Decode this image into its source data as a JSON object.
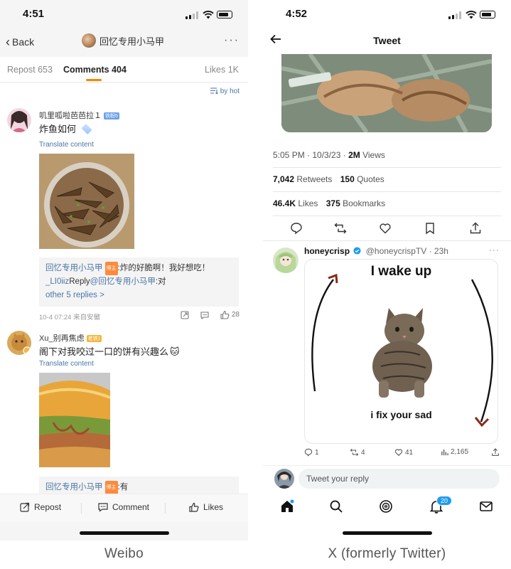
{
  "weibo": {
    "status": {
      "time": "4:51"
    },
    "nav": {
      "back_label": "Back",
      "title": "回忆专用小马甲",
      "more": "···"
    },
    "tabs": {
      "repost": "Repost 653",
      "comments": "Comments 404",
      "likes": "Likes 1K"
    },
    "sort_label": "by hot",
    "comments": [
      {
        "name": "叽里呱啦芭芭拉１",
        "badge": "铁粉5",
        "text": "炸鱼如何",
        "translate": "Translate content",
        "reply_author": "回忆专用小马甲",
        "reply_author_badge": "博主",
        "reply_text": ":炸的好脆啊！我好想吃！",
        "reply_line2_user": "_LI0iiz",
        "reply_line2_mid": "Reply",
        "reply_line2_mention": "@回忆专用小马甲",
        "reply_line2_text": ":对",
        "more_replies": "other 5 replies >",
        "meta": "10-4 07:24 来自安徽",
        "like_count": "28"
      },
      {
        "name": "Xu_别再焦虑",
        "badge": "老铁1",
        "text": "阁下对我咬过一口的饼有兴趣么",
        "translate": "Translate content",
        "reply_author": "回忆专用小马甲",
        "reply_author_badge": "博主",
        "reply_text": ":有"
      }
    ],
    "bottom": {
      "repost": "Repost",
      "comment": "Comment",
      "likes": "Likes"
    },
    "caption": "Weibo"
  },
  "twitter": {
    "status": {
      "time": "4:52"
    },
    "nav": {
      "title": "Tweet"
    },
    "meta_time": "5:05 PM · 10/3/23 · ",
    "meta_views_num": "2M",
    "meta_views_label": " Views",
    "retweets_num": "7,042",
    "retweets_label": " Retweets",
    "quotes_num": "150",
    "quotes_label": " Quotes",
    "likes_num": "46.4K",
    "likes_label": " Likes",
    "bookmarks_num": "375",
    "bookmarks_label": " Bookmarks",
    "reply": {
      "name": "honeycrisp",
      "handle": "@honeycrispTV · 23h",
      "meme_top": "I wake up",
      "meme_bottom": "i fix your sad",
      "replies": "1",
      "retweets": "4",
      "likes": "41",
      "views": "2,165"
    },
    "compose_placeholder": "Tweet your reply",
    "notifications_count": "20",
    "caption": "X (formerly Twitter)"
  }
}
